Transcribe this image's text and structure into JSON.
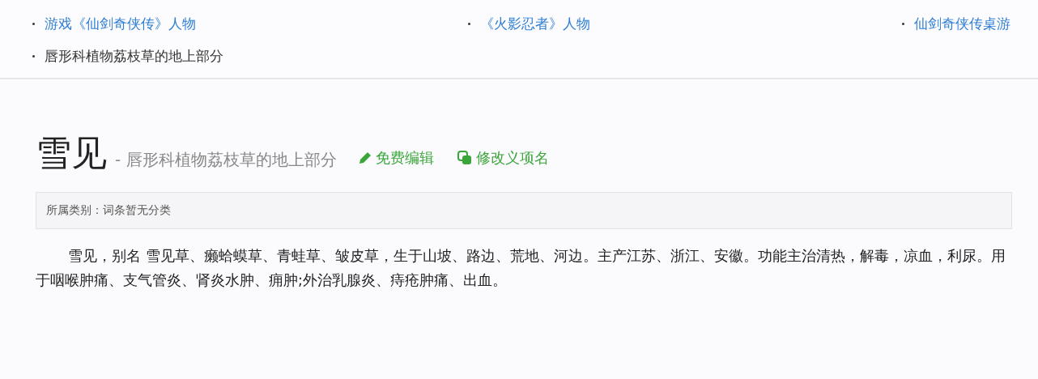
{
  "related": [
    {
      "text": "游戏《仙剑奇侠传》人物",
      "kind": "link"
    },
    {
      "text": "《火影忍者》人物",
      "kind": "link"
    },
    {
      "text": "仙剑奇侠传桌游",
      "kind": "link"
    },
    {
      "text": "唇形科植物荔枝草的地上部分",
      "kind": "plain"
    }
  ],
  "entry": {
    "title": "雪见",
    "subtitle": "- 唇形科植物荔枝草的地上部分",
    "actions": [
      {
        "label": "免费编辑",
        "kind": "edit"
      },
      {
        "label": "修改义项名",
        "kind": "rename"
      }
    ],
    "category": "所属类别：词条暂无分类",
    "summary": "雪见，别名 雪见草、癞蛤蟆草、青蛙草、皱皮草，生于山坡、路边、荒地、河边。主产江苏、浙江、安徽。功能主治清热，解毒，凉血，利尿。用于咽喉肿痛、支气管炎、肾炎水肿、痈肿;外治乳腺炎、痔疮肿痛、出血。"
  }
}
